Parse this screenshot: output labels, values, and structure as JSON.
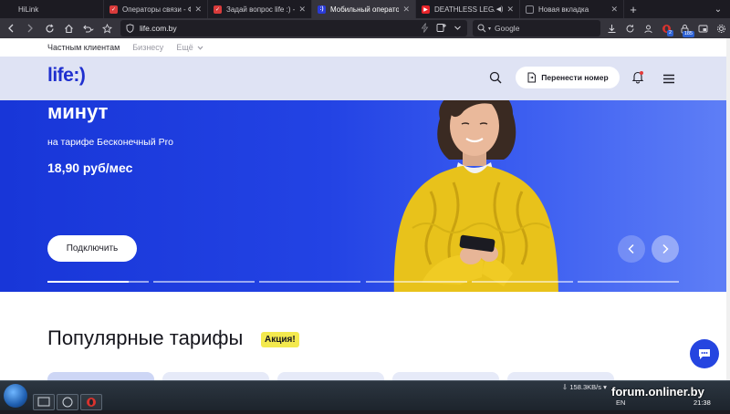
{
  "browser": {
    "tabs": [
      {
        "title": "HiLink",
        "favicon": "blank-icon",
        "color": "#1c1b22",
        "active": false
      },
      {
        "title": "Операторы связи - Фор",
        "favicon": "onliner-icon",
        "color": "#d93b3b",
        "active": false
      },
      {
        "title": "Задай вопрос life :) - Фо",
        "favicon": "onliner-icon",
        "color": "#d93b3b",
        "active": false
      },
      {
        "title": "Мобильный оператор li",
        "favicon": "life-icon",
        "color": "#2a3bd6",
        "active": true
      },
      {
        "title": "DEATHLESS LEGACY",
        "favicon": "youtube-icon",
        "color": "#e8242a",
        "active": false,
        "sound": true
      },
      {
        "title": "Новая вкладка",
        "favicon": "newtab-icon",
        "color": "#8a8a92",
        "active": false
      }
    ],
    "new_tab": "+",
    "url": "life.com.by",
    "search_placeholder": "Google",
    "badges": {
      "opera": "2",
      "vpn": "185"
    }
  },
  "site": {
    "segments": {
      "active": "Частным клиентам",
      "business": "Бизнесу",
      "more": "Ещё"
    },
    "logo": "life:)",
    "transfer_label": "Перенести номер",
    "hero": {
      "title": "минут",
      "subtitle": "на тарифе Бесконечный Pro",
      "price": "18,90  руб/мес",
      "button": "Подключить",
      "slides_total": 6,
      "current_slide_progress": 0.8
    },
    "section_title": "Популярные тарифы",
    "promo_badge": "Акция!"
  },
  "taskbar": {
    "watermark": "forum.onliner.by",
    "speed": "158.3KB/s",
    "lang": "EN",
    "time": "21:38"
  },
  "colors": {
    "brand": "#1f2fcf",
    "hero": "#2343e4",
    "promo": "#f3e94e"
  }
}
